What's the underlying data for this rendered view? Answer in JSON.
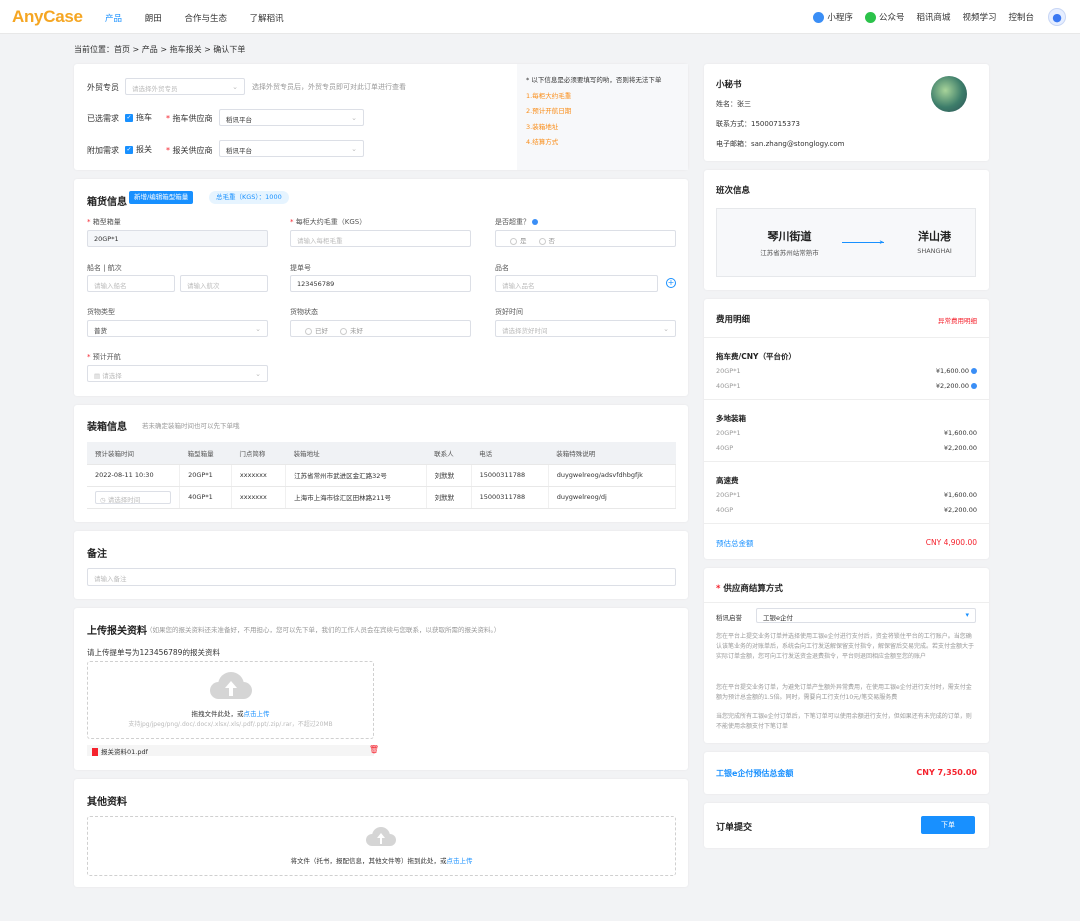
{
  "header": {
    "logo_main": "AnyCase",
    "nav": [
      "产品",
      "朗田",
      "合作与生态",
      "了解稻讯"
    ],
    "right": {
      "mini": "小程序",
      "wechat": "公众号",
      "mall": "稻讯商城",
      "video": "视频学习",
      "console": "控制台"
    }
  },
  "breadcrumb": {
    "label": "当前位置：",
    "path": "首页 > 产品 > 拖车报关 > 确认下单"
  },
  "top": {
    "trade_label": "外贸专员",
    "trade_placeholder": "请选择外贸专员",
    "trade_hint": "选择外贸专员后，外贸专员即可对此订单进行查看",
    "selected_label": "已选需求",
    "selected_check": "拖车",
    "truck_supplier_label": "拖车供应商",
    "truck_supplier_value": "稻讯平台",
    "extra_label": "附加需求",
    "extra_check": "报关",
    "customs_supplier_label": "报关供应商",
    "customs_supplier_value": "稻讯平台",
    "notice_title": "* 以下信息是必须要填写的哟，否则将无法下单",
    "notice_items": [
      "1.每柜大约毛重",
      "2.预计开航日期",
      "3.装箱地址",
      "4.结算方式"
    ]
  },
  "box": {
    "title": "箱货信息",
    "edit_btn": "新增/编辑箱型箱量",
    "weight_tag": "总毛重（KGS）：1000",
    "f_box_label": "箱型箱量",
    "f_box_value": "20GP*1",
    "f_weight_label": "每柜大约毛重（KGS）",
    "f_weight_ph": "请输入每柜毛重",
    "f_heavy_label": "是否超重？",
    "f_heavy_yes": "是",
    "f_heavy_no": "否",
    "f_ship_label": "船名 | 航次",
    "f_ship_ph": "请输入船名",
    "f_voy_ph": "请输入航次",
    "f_bl_label": "提单号",
    "f_bl_value": "123456789",
    "f_port_label": "品名",
    "f_port_ph": "请输入品名",
    "f_cargo_label": "货物类型",
    "f_cargo_value": "普货",
    "f_status_label": "货物状态",
    "f_status_a": "已好",
    "f_status_b": "未好",
    "f_ready_label": "货好时间",
    "f_ready_ph": "请选择货好时间",
    "f_sail_label": "预计开航",
    "f_sail_ph": "请选择"
  },
  "load": {
    "title": "装箱信息",
    "hint": "若未确定装箱时间也可以先下单哦",
    "headers": [
      "预计装箱时间",
      "箱型箱量",
      "门点简称",
      "装箱地址",
      "联系人",
      "电话",
      "装箱特殊说明"
    ],
    "rows": [
      [
        "2022-08-11 10:30",
        "20GP*1",
        "xxxxxxx",
        "江苏省常州市武进区金汇路32号",
        "刘默默",
        "15000311788",
        "duygwelreog/adsvfdhbgfjk"
      ],
      [
        "请选择时间",
        "40GP*1",
        "xxxxxxx",
        "上海市上海市徐汇区田林路211号",
        "刘默默",
        "15000311788",
        "duygwelreog/dj"
      ]
    ]
  },
  "remark": {
    "title": "备注",
    "ph": "请输入备注"
  },
  "upload": {
    "title": "上传报关资料",
    "hint": "（如果您的报关资料还未准备好，不用担心，您可以先下单，我们的工作人员会在宾续与您联系，以获取所需的报关资料。）",
    "bl_line": "请上传提单号为123456789的报关资料",
    "drop_text": "拖拽文件此处，或",
    "drop_link": "点击上传",
    "support": "支持jpg/jpeg/png/.doc/.docx/.xlsx/.xls/.pdf/.ppt/.zip/.rar，不超过20MB",
    "file_name": "报关资料01.pdf"
  },
  "other": {
    "title": "其他资料",
    "drop_text": "将文件（托书，报配信息，其他文件等）拖到此处，或",
    "drop_link": "点击上传"
  },
  "contact": {
    "title": "小秘书",
    "name": "姓名：张三",
    "phone": "联系方式：15000715373",
    "email": "电子邮箱：san.zhang@stonglogy.com"
  },
  "schedule": {
    "title": "班次信息",
    "from_name": "琴川街道",
    "from_sub": "江苏省苏州站常熟市",
    "to_name": "洋山港",
    "to_sub": "SHANGHAI"
  },
  "fee": {
    "title": "费用明细",
    "abnormal": "异常费用明细",
    "groups": [
      {
        "name": "拖车费/CNY（平台价）",
        "items": [
          [
            "20GP*1",
            "¥1,600.00"
          ],
          [
            "40GP*1",
            "¥2,200.00"
          ]
        ]
      },
      {
        "name": "多地装箱",
        "items": [
          [
            "20GP*1",
            "¥1,600.00"
          ],
          [
            "40GP",
            "¥2,200.00"
          ]
        ]
      },
      {
        "name": "高速费",
        "items": [
          [
            "20GP*1",
            "¥1,600.00"
          ],
          [
            "40GP",
            "¥2,200.00"
          ]
        ]
      }
    ],
    "total_label": "预估总金额",
    "total_value": "CNY 4,900.00"
  },
  "settle": {
    "title": "供应商结算方式",
    "pay_label": "稻讯启誉",
    "pay_value": "工银e企付",
    "notes": [
      "您在平台上提交业务订单并选择使用工银e企付进行支付后，资金将锁住平台的工行账户。当您确认该笔业务的对账单后，系统会向工行发送解保留支付指令，解保留后交易完成。若支付金额大于实际订单金额，您可向工行发送资金退费指令，平台则退回相应金额至您的账户",
      "您在平台提交业务订单，为避免订单产生额外异常费用，在使用工银e企付进行支付时，需支付金额为预计总金额的1.5倍。同时，需要向工行支付10元/笔交易服务费",
      "当您完成所有工银e企付订单后，下笔订单可以使用余额进行支付，但如果还有未完成的订单，则不能使用余额支付下笔订单"
    ]
  },
  "epay": {
    "label": "工银e企付预估总金额",
    "value": "CNY 7,350.00"
  },
  "submit": {
    "label": "订单提交",
    "btn": "下单"
  },
  "colors": {
    "primary": "#1890ff",
    "danger": "#f5222d",
    "orange": "#fa8c16"
  }
}
